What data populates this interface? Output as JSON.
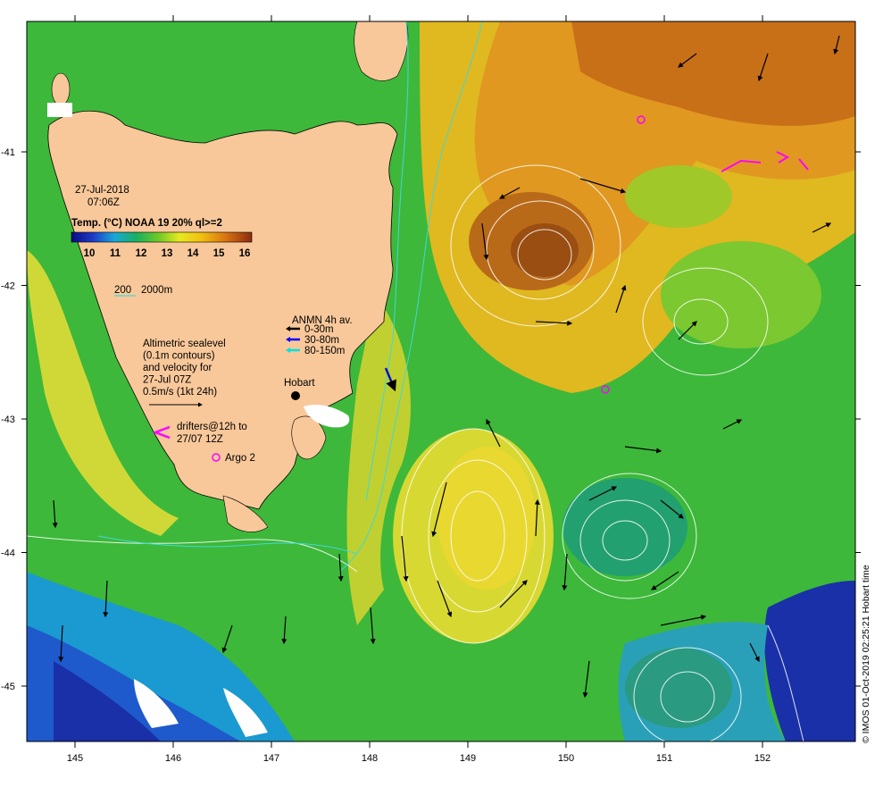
{
  "map": {
    "x_ticks": [
      "145",
      "146",
      "147",
      "148",
      "149",
      "150",
      "151",
      "152"
    ],
    "y_ticks": [
      "-41",
      "-42",
      "-43",
      "-44",
      "-45"
    ]
  },
  "legend": {
    "date": "27-Jul-2018",
    "time": "07:06Z",
    "temp_title": "Temp. (°C) NOAA 19 20% ql>=2",
    "colorbar_ticks": [
      "10",
      "11",
      "12",
      "13",
      "14",
      "15",
      "16"
    ],
    "isobath_200": "200",
    "isobath_2000": "2000m",
    "anmn_title": "ANMN 4h av.",
    "anmn_items": [
      {
        "label": "0-30m",
        "color": "#000000"
      },
      {
        "label": "30-80m",
        "color": "#0000ff"
      },
      {
        "label": "80-150m",
        "color": "#00e0e0"
      }
    ],
    "altimetry_lines": [
      "Altimetric sealevel",
      "(0.1m contours)",
      "and velocity for",
      "27-Jul 07Z",
      "0.5m/s (1kt 24h)"
    ],
    "drifters_lines": [
      "drifters@12h to",
      "27/07 12Z"
    ],
    "argo_label": "Argo 2",
    "hobart_label": "Hobart",
    "colors": {
      "drifter": "#ff00ff",
      "argo": "#ff00ff",
      "land": "#f8c89a"
    }
  },
  "credit": "© IMOS 01-Oct-2019 02:25:21 Hobart time"
}
